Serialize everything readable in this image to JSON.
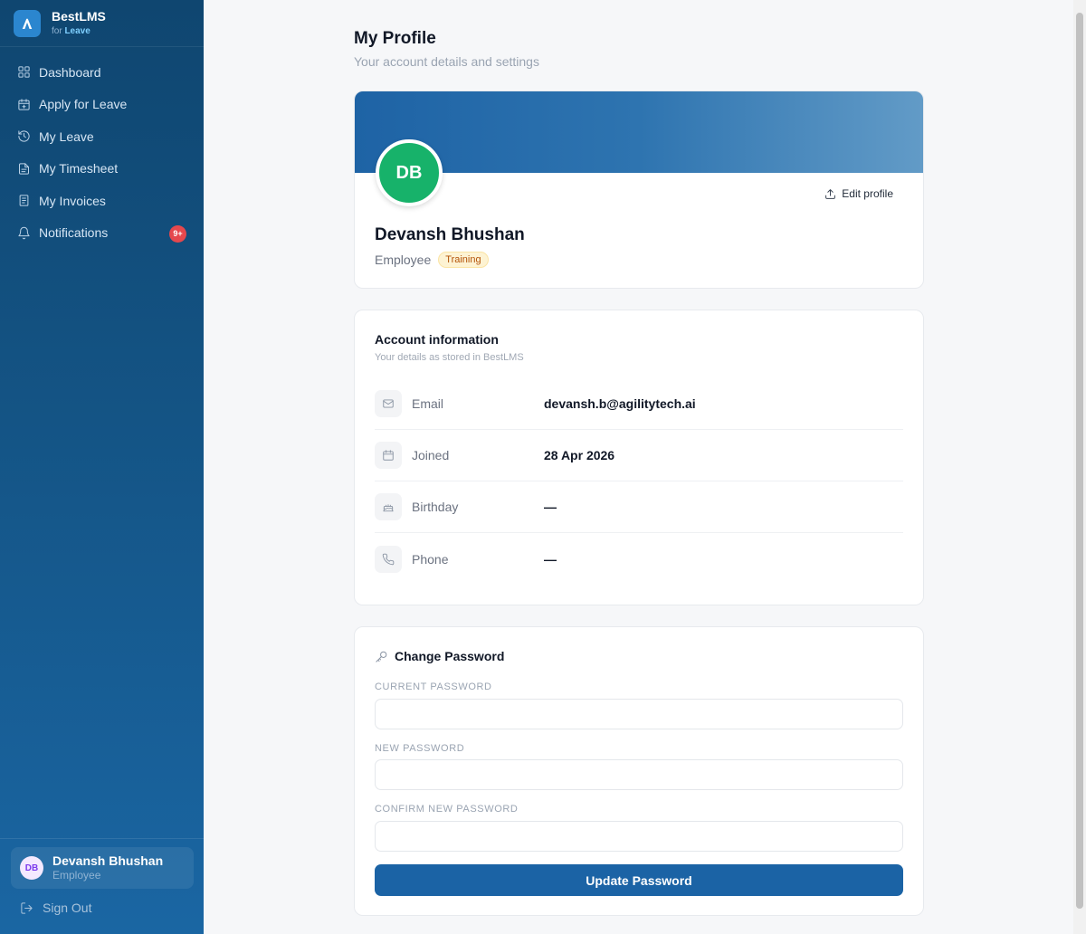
{
  "brand": {
    "name": "BestLMS",
    "sub_prefix": "for",
    "sub_product": "Leave"
  },
  "nav": [
    {
      "label": "Dashboard",
      "icon": "grid-icon"
    },
    {
      "label": "Apply for Leave",
      "icon": "calendar-plus-icon"
    },
    {
      "label": "My Leave",
      "icon": "history-icon"
    },
    {
      "label": "My Timesheet",
      "icon": "file-text-icon"
    },
    {
      "label": "My Invoices",
      "icon": "receipt-icon"
    },
    {
      "label": "Notifications",
      "icon": "bell-icon",
      "badge": "9+"
    }
  ],
  "sidebar_user": {
    "initials": "DB",
    "name": "Devansh Bhushan",
    "role": "Employee"
  },
  "sign_out": "Sign Out",
  "page": {
    "title": "My Profile",
    "subtitle": "Your account details and settings"
  },
  "profile": {
    "initials": "DB",
    "name": "Devansh Bhushan",
    "role": "Employee",
    "tag": "Training",
    "edit_label": "Edit profile",
    "banner_color": "#1e63a5",
    "avatar_color": "#17b26a"
  },
  "account": {
    "title": "Account information",
    "subtitle": "Your details as stored in BestLMS",
    "rows": [
      {
        "label": "Email",
        "value": "devansh.b@agilitytech.ai",
        "icon": "mail-icon"
      },
      {
        "label": "Joined",
        "value": "28 Apr 2026",
        "icon": "calendar-icon"
      },
      {
        "label": "Birthday",
        "value": "—",
        "icon": "cake-icon"
      },
      {
        "label": "Phone",
        "value": "—",
        "icon": "phone-icon"
      }
    ]
  },
  "password": {
    "title": "Change Password",
    "current_label": "CURRENT PASSWORD",
    "new_label": "NEW PASSWORD",
    "confirm_label": "CONFIRM NEW PASSWORD",
    "current_value": "",
    "new_value": "",
    "confirm_value": "",
    "button": "Update Password",
    "button_color": "#1b63a5"
  }
}
